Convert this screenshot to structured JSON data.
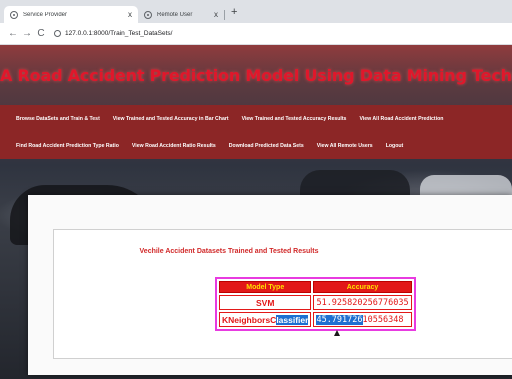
{
  "browser": {
    "tabs": [
      {
        "title": "Service Provider",
        "active": true
      },
      {
        "title": "Remote User",
        "active": false
      }
    ],
    "close_glyph": "x",
    "new_tab_glyph": "+",
    "url": "127.0.0.1:8000/Train_Test_DataSets/",
    "nav": {
      "back": "←",
      "forward": "→",
      "reload": "C"
    }
  },
  "header": {
    "site_title": "A Road Accident Prediction Model Using Data Mining Techniques",
    "title_color": "#e0172b",
    "menu_bar_color": "#8c2626"
  },
  "menu": {
    "row1": [
      "Browse DataSets and Train & Test",
      "View Trained and Tested Accuracy in Bar Chart",
      "View Trained and Tested Accuracy Results",
      "View All Road Accident Prediction"
    ],
    "row2": [
      "Find Road Accident Prediction Type Ratio",
      "View Road Accident Ratio Results",
      "Download Predicted Data Sets",
      "View All Remote Users",
      "Logout"
    ]
  },
  "results": {
    "title": "Vechile Accident Datasets Trained and Tested Results",
    "headers": {
      "model": "Model Type",
      "accuracy": "Accuracy"
    },
    "rows": [
      {
        "model": "SVM",
        "accuracy": "51.925820256776035"
      },
      {
        "model_plain": "KNeighborsC",
        "model_selected": "lassifier",
        "acc_selected": "45.791726",
        "acc_plain": "10556348"
      }
    ],
    "colors": {
      "header_bg": "#e21818",
      "header_text": "#ffe000",
      "table_border": "#e83be0",
      "selection": "#1f6fd1"
    }
  }
}
